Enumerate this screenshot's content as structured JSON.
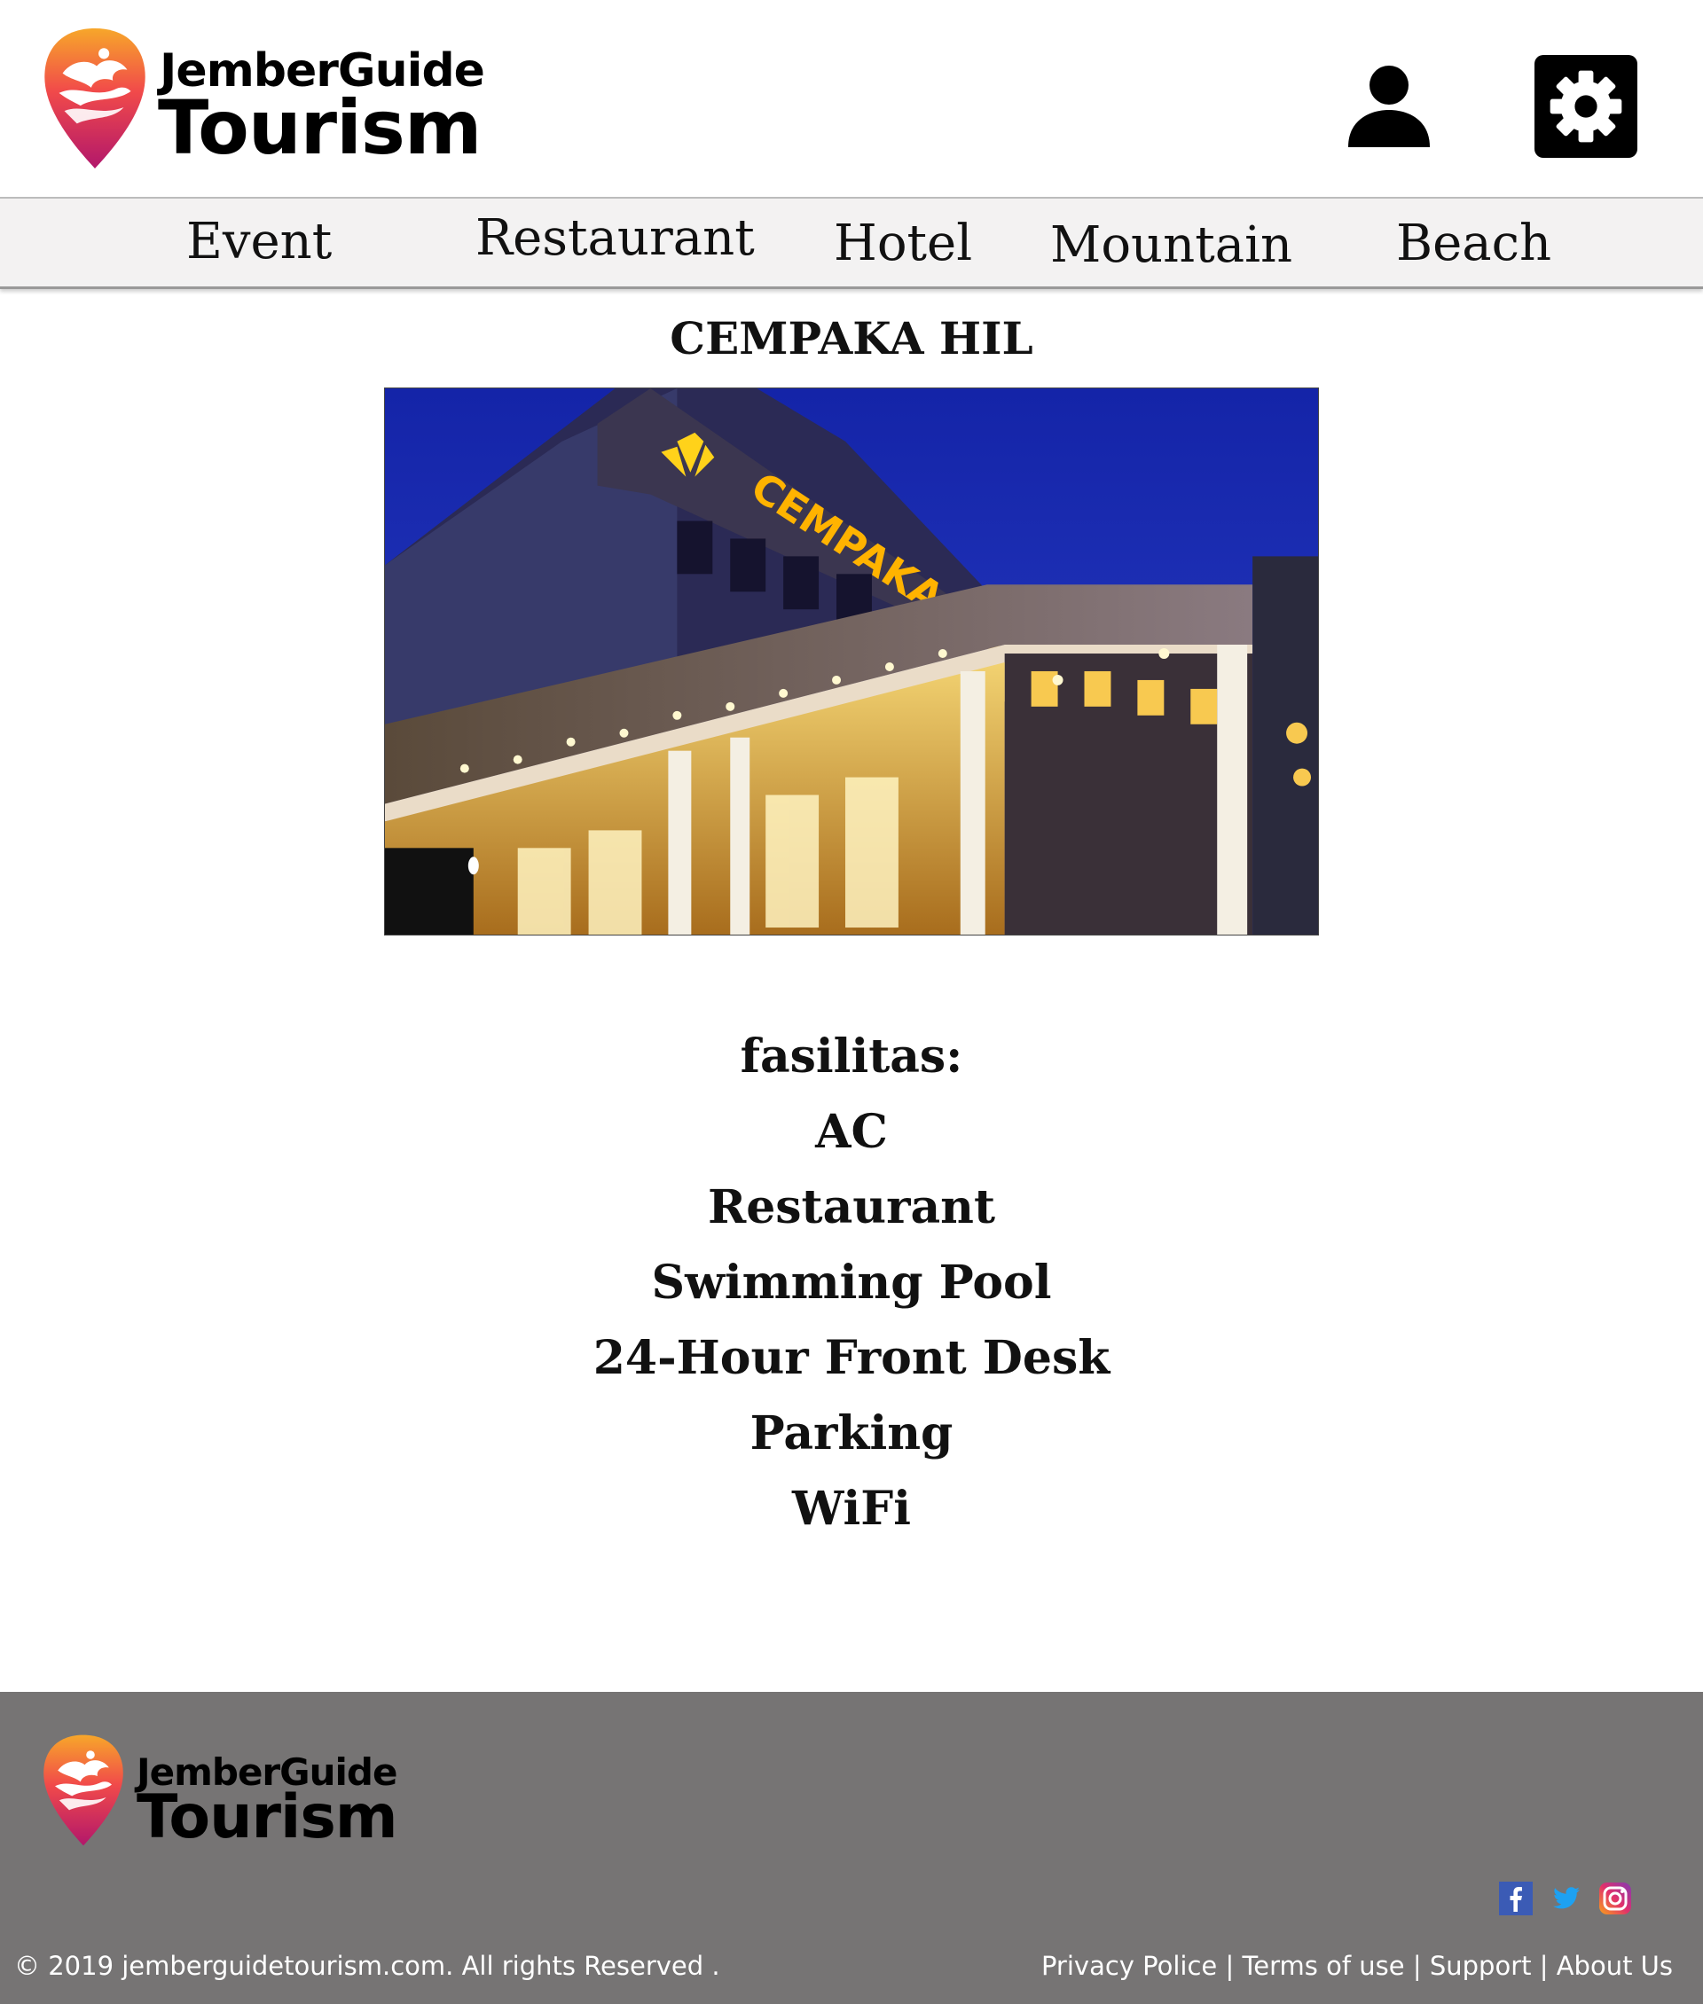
{
  "header": {
    "logo": {
      "line1": "JemberGuide",
      "line2": "Tourism"
    },
    "user_icon": "user-icon",
    "settings_icon": "gear-icon"
  },
  "nav": {
    "items": [
      {
        "label": "Event"
      },
      {
        "label": "Restaurant"
      },
      {
        "label": "Hotel"
      },
      {
        "label": "Mountain"
      },
      {
        "label": "Beach"
      }
    ]
  },
  "main": {
    "title": "CEMPAKA HIL",
    "photo_sign": "CEMPAKA HIL",
    "facilities_heading": "fasilitas:",
    "facilities": [
      "AC",
      "Restaurant",
      "Swimming Pool",
      "24-Hour Front Desk",
      "Parking",
      "WiFi"
    ]
  },
  "footer": {
    "logo": {
      "line1": "JemberGuide",
      "line2": "Tourism"
    },
    "social": [
      "facebook-icon",
      "twitter-icon",
      "instagram-icon"
    ],
    "copyright": "© 2019 jemberguidetourism.com. All rights Reserved .",
    "links": [
      {
        "label": "Privacy Police"
      },
      {
        "label": "Terms of use"
      },
      {
        "label": "Support"
      },
      {
        "label": "About Us"
      }
    ],
    "separator": " | "
  },
  "colors": {
    "nav_bg": "#f3f2f2",
    "footer_bg": "#767474",
    "logo_gradient_top": "#f7a72a",
    "logo_gradient_bottom": "#b2176b",
    "photo_sky": "#1a2fb8",
    "photo_sign": "#ffb300"
  }
}
